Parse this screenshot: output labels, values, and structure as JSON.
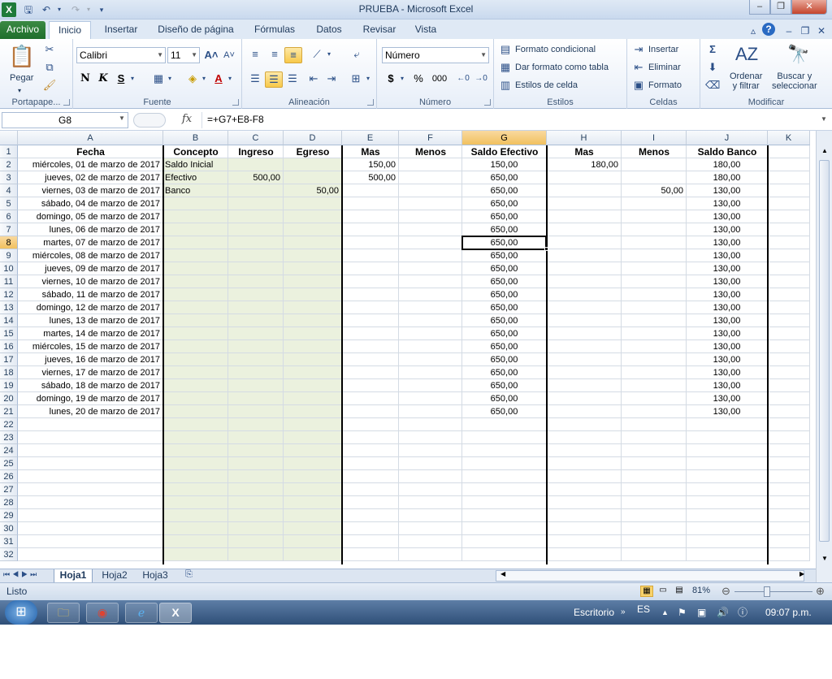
{
  "window": {
    "title": "PRUEBA  -  Microsoft Excel",
    "minimize": "–",
    "restore": "❐",
    "close": "✕"
  },
  "tabs": [
    "Archivo",
    "Inicio",
    "Insertar",
    "Diseño de página",
    "Fórmulas",
    "Datos",
    "Revisar",
    "Vista"
  ],
  "ribbon": {
    "portapapeles": {
      "label": "Portapape...",
      "pegar": "Pegar"
    },
    "fuente": {
      "label": "Fuente",
      "font_name": "Calibri",
      "font_size": "11",
      "bold": "N",
      "italic": "K",
      "underline": "S"
    },
    "alineacion": {
      "label": "Alineación"
    },
    "numero": {
      "label": "Número",
      "format": "Número",
      "currency": "$",
      "percent": "%",
      "thousands": "000"
    },
    "estilos": {
      "label": "Estilos",
      "formato_condicional": "Formato condicional",
      "dar_formato_tabla": "Dar formato como tabla",
      "estilos_celda": "Estilos de celda"
    },
    "celdas": {
      "label": "Celdas",
      "insertar": "Insertar",
      "eliminar": "Eliminar",
      "formato": "Formato"
    },
    "modificar": {
      "label": "Modificar",
      "ordenar": "Ordenar\ny filtrar",
      "buscar": "Buscar y\nseleccionar"
    }
  },
  "formula_bar": {
    "name_box": "G8",
    "fx": "fx",
    "formula": "=+G7+E8-F8"
  },
  "columns": [
    "A",
    "B",
    "C",
    "D",
    "E",
    "F",
    "G",
    "H",
    "I",
    "J",
    "K"
  ],
  "selected_column": "G",
  "selected_row": 8,
  "headers": {
    "A": "Fecha",
    "B": "Concepto",
    "C": "Ingreso",
    "D": "Egreso",
    "E": "Mas",
    "F": "Menos",
    "G": "Saldo Efectivo",
    "H": "Mas",
    "I": "Menos",
    "J": "Saldo Banco"
  },
  "rows": [
    {
      "A": "miércoles, 01 de marzo de 2017",
      "B": "Saldo Inicial",
      "C": "",
      "D": "",
      "E": "150,00",
      "F": "",
      "G": "150,00",
      "H": "180,00",
      "I": "",
      "J": "180,00"
    },
    {
      "A": "jueves, 02 de marzo de 2017",
      "B": "Efectivo",
      "C": "500,00",
      "D": "",
      "E": "500,00",
      "F": "",
      "G": "650,00",
      "H": "",
      "I": "",
      "J": "180,00"
    },
    {
      "A": "viernes, 03 de marzo de 2017",
      "B": "Banco",
      "C": "",
      "D": "50,00",
      "E": "",
      "F": "",
      "G": "650,00",
      "H": "",
      "I": "50,00",
      "J": "130,00"
    },
    {
      "A": "sábado, 04 de marzo de 2017",
      "G": "650,00",
      "J": "130,00"
    },
    {
      "A": "domingo, 05 de marzo de 2017",
      "G": "650,00",
      "J": "130,00"
    },
    {
      "A": "lunes, 06 de marzo de 2017",
      "G": "650,00",
      "J": "130,00"
    },
    {
      "A": "martes, 07 de marzo de 2017",
      "G": "650,00",
      "J": "130,00"
    },
    {
      "A": "miércoles, 08 de marzo de 2017",
      "G": "650,00",
      "J": "130,00"
    },
    {
      "A": "jueves, 09 de marzo de 2017",
      "G": "650,00",
      "J": "130,00"
    },
    {
      "A": "viernes, 10 de marzo de 2017",
      "G": "650,00",
      "J": "130,00"
    },
    {
      "A": "sábado, 11 de marzo de 2017",
      "G": "650,00",
      "J": "130,00"
    },
    {
      "A": "domingo, 12 de marzo de 2017",
      "G": "650,00",
      "J": "130,00"
    },
    {
      "A": "lunes, 13 de marzo de 2017",
      "G": "650,00",
      "J": "130,00"
    },
    {
      "A": "martes, 14 de marzo de 2017",
      "G": "650,00",
      "J": "130,00"
    },
    {
      "A": "miércoles, 15 de marzo de 2017",
      "G": "650,00",
      "J": "130,00"
    },
    {
      "A": "jueves, 16 de marzo de 2017",
      "G": "650,00",
      "J": "130,00"
    },
    {
      "A": "viernes, 17 de marzo de 2017",
      "G": "650,00",
      "J": "130,00"
    },
    {
      "A": "sábado, 18 de marzo de 2017",
      "G": "650,00",
      "J": "130,00"
    },
    {
      "A": "domingo, 19 de marzo de 2017",
      "G": "650,00",
      "J": "130,00"
    },
    {
      "A": "lunes, 20 de marzo de 2017",
      "G": "650,00",
      "J": "130,00"
    }
  ],
  "sheets": [
    "Hoja1",
    "Hoja2",
    "Hoja3"
  ],
  "status": {
    "ready": "Listo",
    "zoom": "81%"
  },
  "taskbar": {
    "desktop": "Escritorio",
    "lang": "ES",
    "time": "09:07 p.m."
  },
  "colors": {
    "concept_fill": "#ebf1de",
    "selection_header": "#f1c15f",
    "archivo_tab": "#1f6e2c"
  }
}
